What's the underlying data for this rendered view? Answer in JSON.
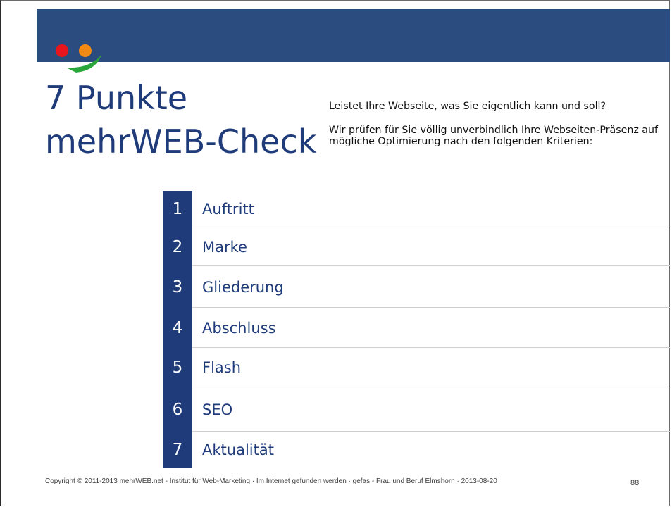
{
  "slide": {
    "title_line1": "7 Punkte",
    "title_line2": "mehrWEB-Check",
    "intro_question": "Leistet Ihre Webseite, was Sie eigentlich kann und soll?",
    "intro_text": "Wir prüfen für Sie völlig unverbindlich Ihre Webseiten-Präsenz auf mögliche Optimierung nach den folgenden Kriterien:",
    "criteria": [
      {
        "number": "1",
        "label": "Auftritt"
      },
      {
        "number": "2",
        "label": "Marke"
      },
      {
        "number": "3",
        "label": "Gliederung"
      },
      {
        "number": "4",
        "label": "Abschluss"
      },
      {
        "number": "5",
        "label": "Flash"
      },
      {
        "number": "6",
        "label": "SEO"
      },
      {
        "number": "7",
        "label": "Aktualität"
      }
    ]
  },
  "footer": {
    "text": "Copyright © 2011-2013 mehrWEB.net - Institut für Web-Marketing · Im Internet gefunden werden · gefas - Frau und Beruf Elmshorn · 2013-08-20",
    "page_number": "88"
  },
  "logo": {
    "icon": "smiley-logo-icon",
    "colors": {
      "dot_left": "#e8141e",
      "dot_right": "#f08a14",
      "smile": "#2aa63a"
    }
  },
  "colors": {
    "header_band": "#2b4c7e",
    "title": "#1f3b7a",
    "number_box": "#1f3b7a",
    "divider": "#cfcfcf"
  }
}
